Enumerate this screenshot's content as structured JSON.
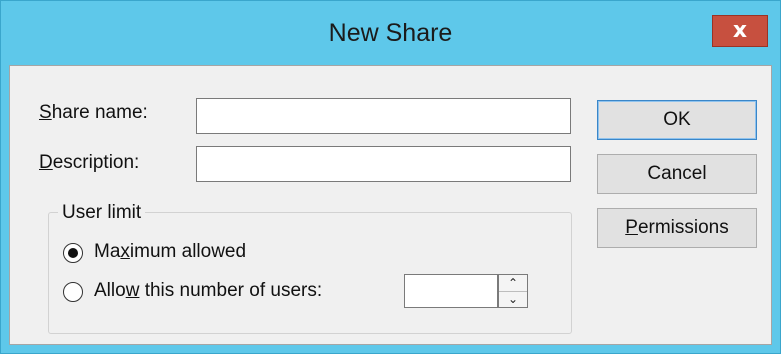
{
  "window": {
    "title": "New Share",
    "close_glyph": "x"
  },
  "fields": {
    "share_name": {
      "label_mnemonic": "S",
      "label_rest": "hare name:",
      "value": ""
    },
    "description": {
      "label_mnemonic": "D",
      "label_rest": "escription:",
      "value": ""
    }
  },
  "user_limit": {
    "title": "User limit",
    "option_max": {
      "pre": "Ma",
      "mnemonic": "x",
      "post": "imum allowed",
      "selected": true
    },
    "option_allow": {
      "pre": "Allo",
      "mnemonic": "w",
      "post": " this number of users:",
      "selected": false
    },
    "count_value": ""
  },
  "buttons": {
    "ok": "OK",
    "cancel": "Cancel",
    "permissions": {
      "mnemonic": "P",
      "rest": "ermissions"
    }
  },
  "colors": {
    "titlebar": "#5ec8ea",
    "close_button": "#c7503f",
    "client_area": "#f0f0f0"
  },
  "icons": {
    "spin_up": "chevron-up-icon",
    "spin_down": "chevron-down-icon"
  }
}
